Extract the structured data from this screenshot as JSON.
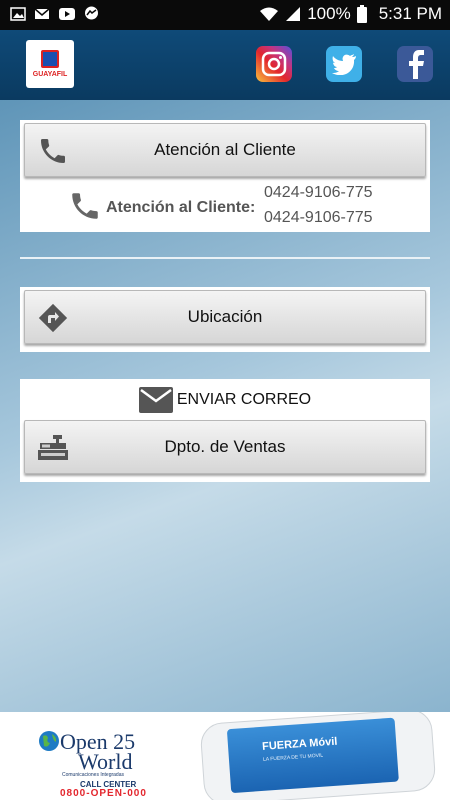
{
  "status_bar": {
    "battery": "100%",
    "time": "5:31 PM"
  },
  "header": {
    "logo_text": "GUAYAFIL",
    "social": [
      "instagram-icon",
      "twitter-icon",
      "facebook-icon"
    ]
  },
  "atencion": {
    "button_label": "Atención al Cliente",
    "label": "Atención al Cliente:",
    "phones": [
      "0424-9106-775",
      "0424-9106-775"
    ]
  },
  "ubicacion": {
    "button_label": "Ubicación"
  },
  "correo": {
    "title": "ENVIAR CORREO",
    "button_label": "Dpto. de Ventas"
  },
  "ad": {
    "brand_line1": "Open",
    "brand_number": "25",
    "brand_line2": "World",
    "tagline": "Comunicaciones Integradas",
    "call_center": "CALL CENTER",
    "phone": "0800-OPEN-000",
    "phone_screen_brand": "FUERZA Móvil",
    "phone_screen_tagline": "LA FUERZA DE TU MOVIL"
  },
  "colors": {
    "header_bg": "#0f4a78",
    "accent_red": "#e3262d",
    "twitter": "#3fb0e8",
    "facebook": "#3b5998"
  }
}
